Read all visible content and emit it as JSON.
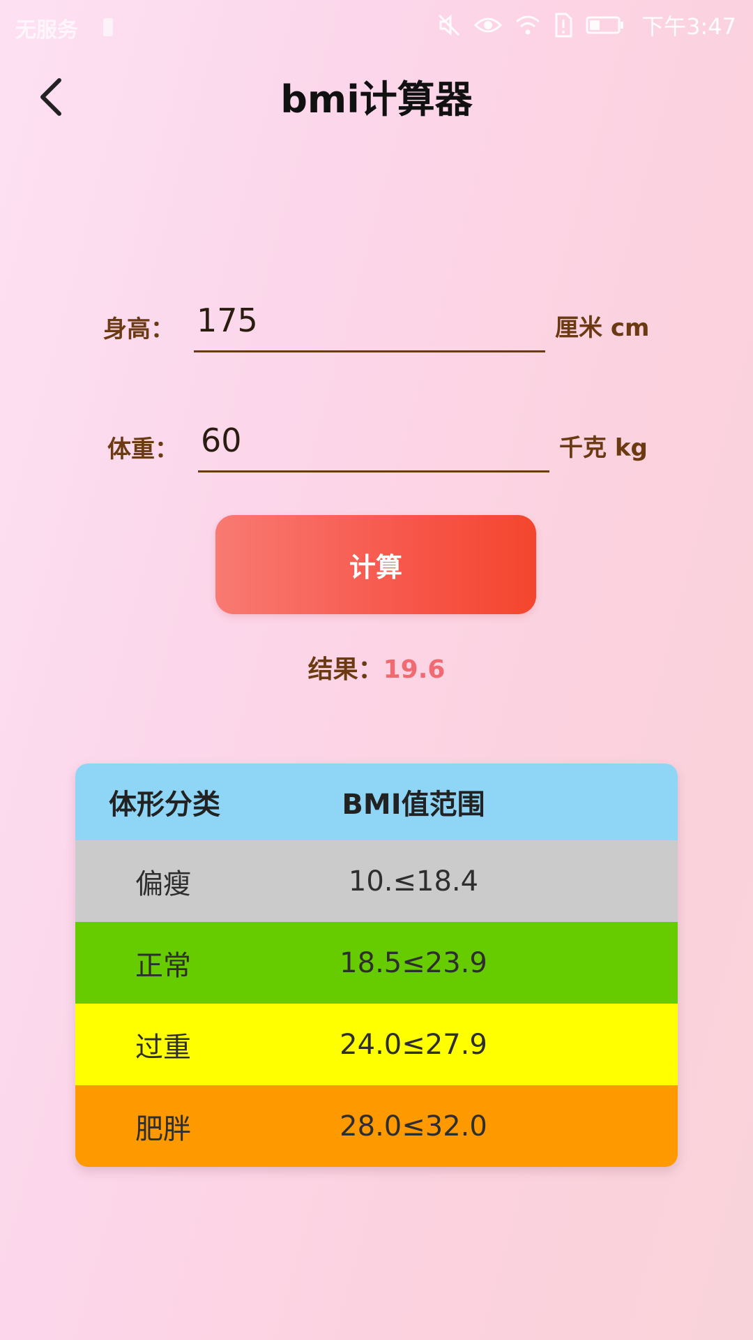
{
  "status_bar": {
    "left_text": "无服务",
    "time": "下午3:47",
    "icons": [
      "mute-icon",
      "eye-icon",
      "wifi-icon",
      "sim-alert-icon",
      "battery-icon"
    ]
  },
  "header": {
    "title": "bmi计算器",
    "back_icon": "chevron-left-icon"
  },
  "form": {
    "height": {
      "label": "身高：",
      "value": "175",
      "unit": "厘米 cm"
    },
    "weight": {
      "label": "体重：",
      "value": "60",
      "unit": "千克 kg"
    }
  },
  "calculate_button": {
    "label": "计算"
  },
  "result": {
    "label": "结果：",
    "value": "19.6"
  },
  "colors": {
    "label_brown": "#6b3a12",
    "result_pink": "#f06a72",
    "button_gradient_start": "#f87a72",
    "button_gradient_end": "#f4462e"
  },
  "bmi_table": {
    "headers": {
      "category": "体形分类",
      "range": "BMI值范围"
    },
    "header_color": "#8fd6f6",
    "rows": [
      {
        "category": "偏瘦",
        "range": "10.≤18.4",
        "color": "#cbcbcb"
      },
      {
        "category": "正常",
        "range": "18.5≤23.9",
        "color": "#66cc00"
      },
      {
        "category": "过重",
        "range": "24.0≤27.9",
        "color": "#ffff00"
      },
      {
        "category": "肥胖",
        "range": "28.0≤32.0",
        "color": "#ff9900"
      }
    ]
  }
}
